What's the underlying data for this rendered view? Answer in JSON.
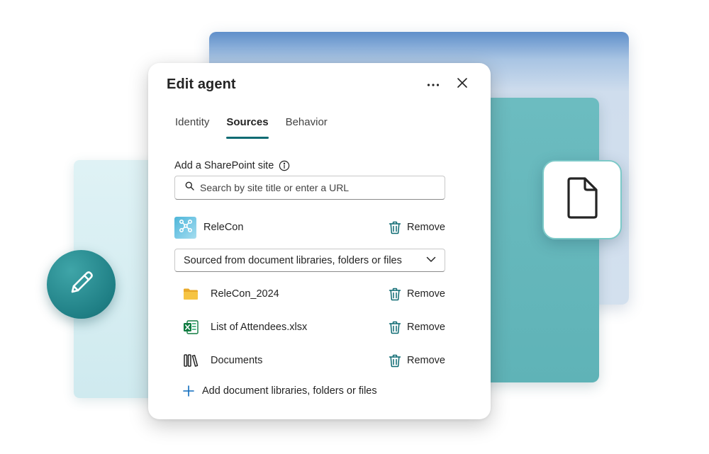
{
  "dialog": {
    "title": "Edit agent",
    "more_icon": "more-horizontal-icon",
    "close_icon": "close-icon"
  },
  "tabs": [
    {
      "label": "Identity",
      "active": false
    },
    {
      "label": "Sources",
      "active": true
    },
    {
      "label": "Behavior",
      "active": false
    }
  ],
  "sharepoint": {
    "label": "Add a SharePoint site",
    "search_placeholder": "Search by site title or enter a URL"
  },
  "site": {
    "name": "ReleCon",
    "remove_label": "Remove"
  },
  "source_scope": {
    "selected": "Sourced from document libraries, folders or files"
  },
  "items": [
    {
      "name": "ReleCon_2024",
      "icon": "folder-icon",
      "remove_label": "Remove"
    },
    {
      "name": "List of Attendees.xlsx",
      "icon": "excel-file-icon",
      "remove_label": "Remove"
    },
    {
      "name": "Documents",
      "icon": "library-icon",
      "remove_label": "Remove"
    }
  ],
  "add_link": "Add document libraries, folders or files",
  "colors": {
    "accent": "#0f6b73",
    "plus": "#0f6cbd",
    "folder": "#f6c443",
    "excel": "#107c41"
  }
}
